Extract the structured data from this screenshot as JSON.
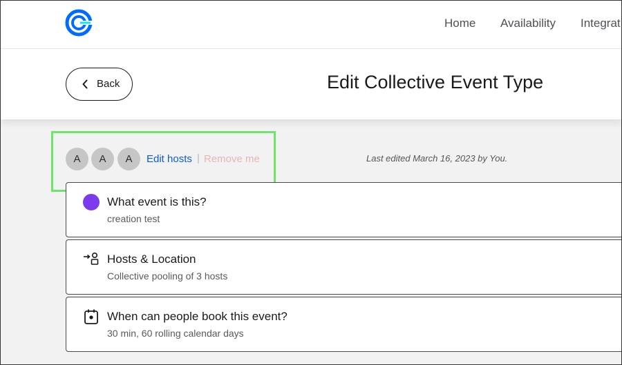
{
  "nav": {
    "logo_icon": "calendly-logo-icon",
    "links": [
      "Home",
      "Availability",
      "Integrat"
    ]
  },
  "header": {
    "back_label": "Back",
    "title": "Edit Collective Event Type"
  },
  "hosts": {
    "avatars": [
      "A",
      "A",
      "A"
    ],
    "edit_hosts": "Edit hosts",
    "separator": "|",
    "remove_me": "Remove me",
    "last_edited": "Last edited March 16, 2023 by You."
  },
  "cards": [
    {
      "icon": "purple-dot-icon",
      "title": "What event is this?",
      "subtitle": "creation test"
    },
    {
      "icon": "hosts-location-icon",
      "title": "Hosts & Location",
      "subtitle": "Collective pooling of 3 hosts"
    },
    {
      "icon": "calendar-icon",
      "title": "When can people book this event?",
      "subtitle": "30 min, 60 rolling calendar days"
    }
  ],
  "colors": {
    "brand_blue": "#006bff",
    "link_blue": "#0b5cd5",
    "event_purple": "#7c3aed",
    "highlight_green": "#6fe46a",
    "remove_pink": "#e8b5b5"
  }
}
